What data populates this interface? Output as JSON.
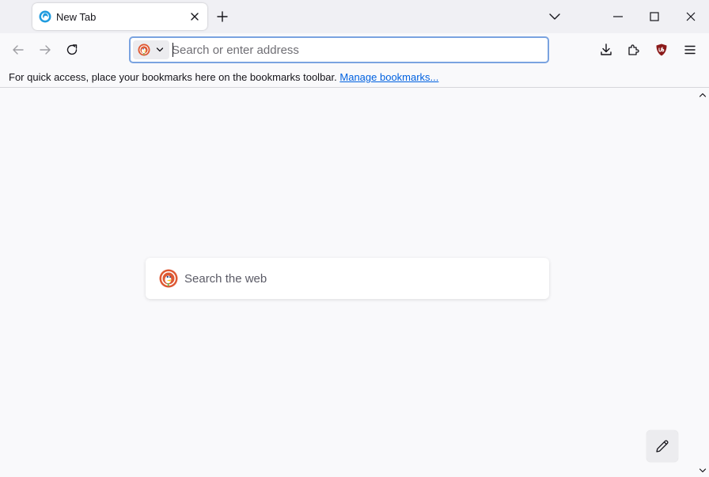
{
  "colors": {
    "accent_focus": "#7aa3e0",
    "link": "#0061e0",
    "ublock_red": "#8b1a1a",
    "ddg_orange": "#de5833"
  },
  "tabs": [
    {
      "title": "New Tab",
      "favicon": "firefox-icon",
      "selected": true
    }
  ],
  "titlebar": {
    "new_tab_icon": "plus-icon",
    "list_all_tabs_icon": "chevron-down-icon",
    "window_controls": [
      "minimize-icon",
      "maximize-icon",
      "close-icon"
    ]
  },
  "navbar": {
    "back_icon": "arrow-left-icon",
    "forward_icon": "arrow-right-icon",
    "reload_icon": "reload-icon",
    "urlbar": {
      "placeholder": "Search or enter address",
      "value": "",
      "engine_icon": "duckduckgo-icon"
    },
    "toolbar_icons": [
      "download-icon",
      "extensions-icon",
      "ublock-origin-icon",
      "hamburger-menu-icon"
    ]
  },
  "bookmarks_bar": {
    "message": "For quick access, place your bookmarks here on the bookmarks toolbar.",
    "link_label": "Manage bookmarks..."
  },
  "newtab": {
    "search_placeholder": "Search the web",
    "search_engine_icon": "duckduckgo-icon",
    "customize_icon": "pencil-icon"
  }
}
